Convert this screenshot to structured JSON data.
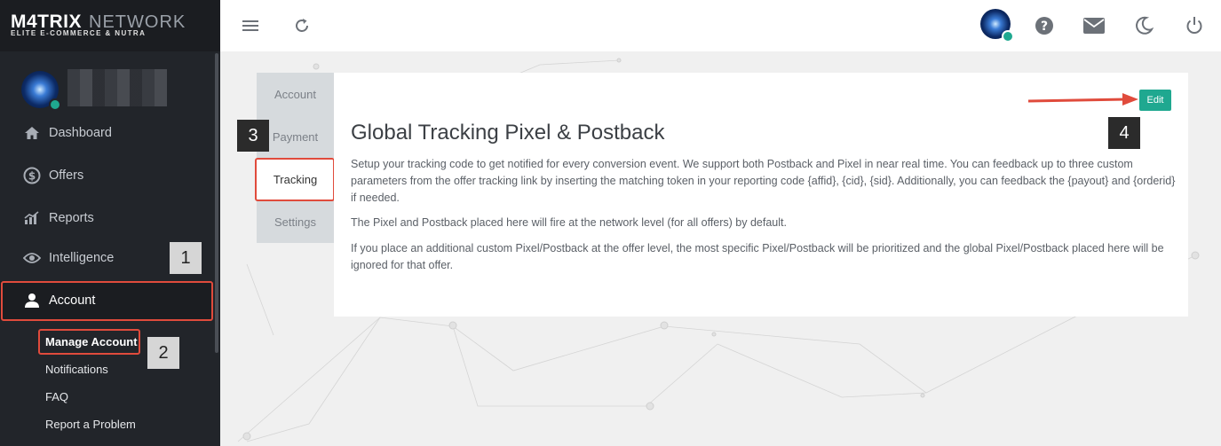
{
  "brand": {
    "logo_main": "M4TRIX",
    "logo_network": "NETWORK",
    "tagline": "ELITE E-COMMERCE & NUTRA"
  },
  "sidebar": {
    "nav": [
      {
        "label": "Dashboard",
        "icon": "home-icon"
      },
      {
        "label": "Offers",
        "icon": "dollar-circle-icon"
      },
      {
        "label": "Reports",
        "icon": "chart-bars-icon"
      },
      {
        "label": "Intelligence",
        "icon": "eye-icon"
      },
      {
        "label": "Account",
        "icon": "user-icon"
      }
    ],
    "account_sub": [
      {
        "label": "Manage Account"
      },
      {
        "label": "Notifications"
      },
      {
        "label": "FAQ"
      },
      {
        "label": "Report a Problem"
      }
    ]
  },
  "topbar": {
    "icons": [
      "menu-icon",
      "refresh-icon",
      "avatar",
      "help-icon",
      "mail-icon",
      "moon-icon",
      "power-icon"
    ]
  },
  "annotations": {
    "one": "1",
    "two": "2",
    "three": "3",
    "four": "4"
  },
  "tabs": [
    {
      "label": "Account"
    },
    {
      "label": "Payment"
    },
    {
      "label": "Tracking"
    },
    {
      "label": "Settings"
    }
  ],
  "content": {
    "title": "Global Tracking Pixel & Postback",
    "edit_label": "Edit",
    "para1": "Setup your tracking code to get notified for every conversion event. We support both Postback and Pixel in near real time. You can feedback up to three custom parameters from the offer tracking link by inserting the matching token in your reporting code {affid}, {cid}, {sid}. Additionally, you can feedback the {payout} and {orderid} if needed.",
    "para2": "The Pixel and Postback placed here will fire at the network level (for all offers) by default.",
    "para3": "If you place an additional custom Pixel/Postback at the offer level, the most specific Pixel/Postback will be prioritized and the global Pixel/Postback placed here will be ignored for that offer."
  },
  "colors": {
    "sidebar_bg": "#22252a",
    "accent_teal": "#1fa890",
    "highlight_red": "#e04b3c"
  }
}
